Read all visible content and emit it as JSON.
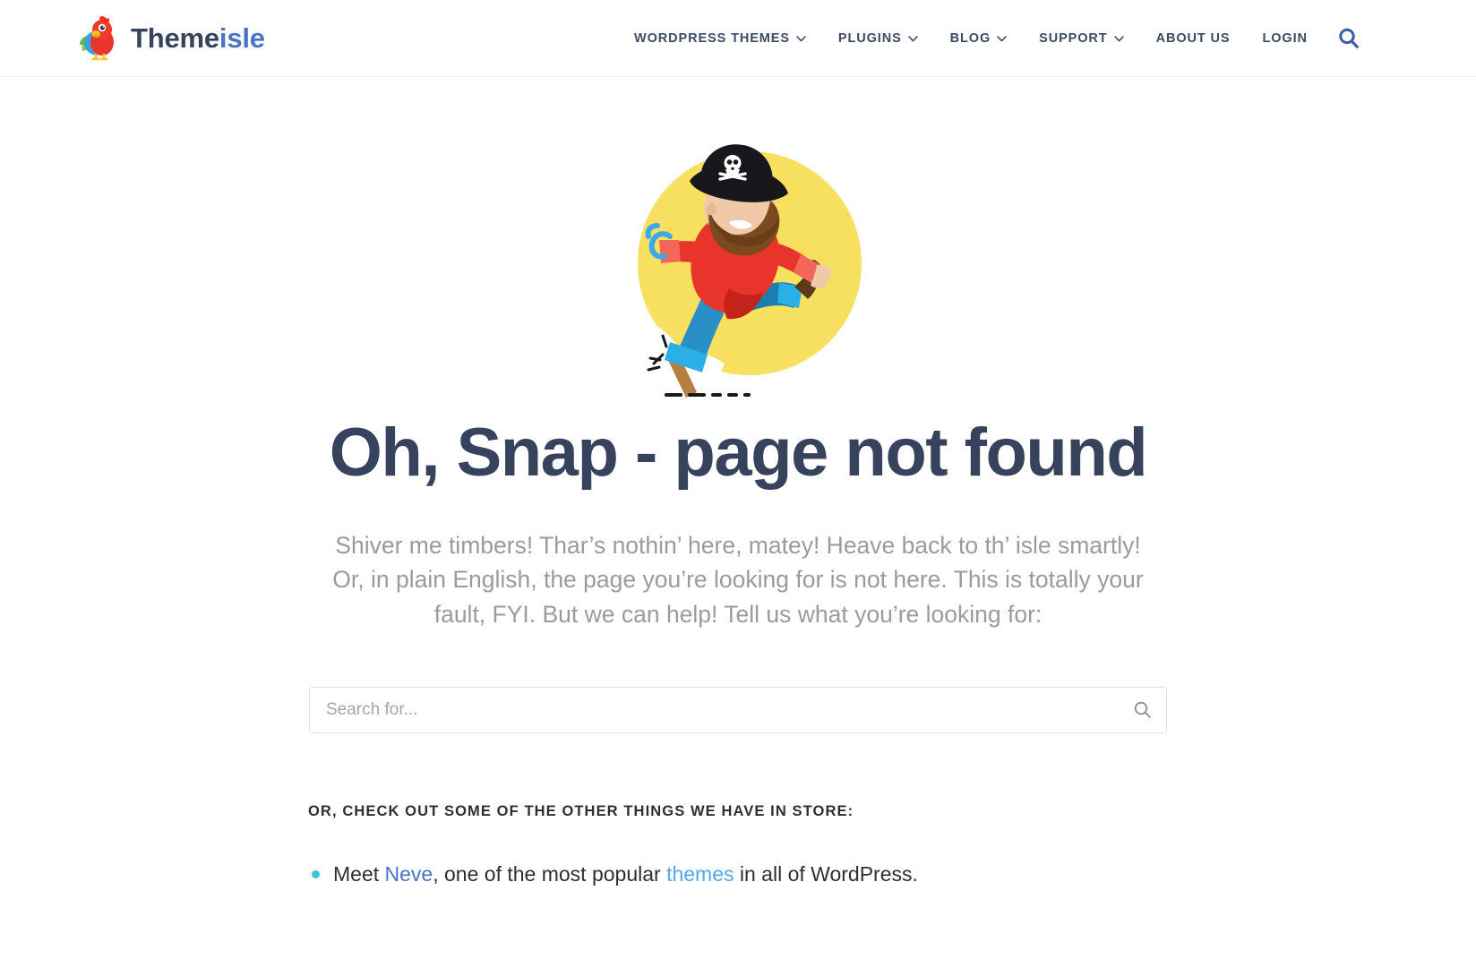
{
  "header": {
    "brand": {
      "name_part1": "Theme",
      "name_part2": "isle",
      "logo_icon": "parrot-logo-icon"
    },
    "nav_items": [
      {
        "label": "WORDPRESS THEMES",
        "has_dropdown": true
      },
      {
        "label": "PLUGINS",
        "has_dropdown": true
      },
      {
        "label": "BLOG",
        "has_dropdown": true
      },
      {
        "label": "SUPPORT",
        "has_dropdown": true
      },
      {
        "label": "ABOUT US",
        "has_dropdown": false
      },
      {
        "label": "LOGIN",
        "has_dropdown": false
      }
    ],
    "search_icon": "search-icon",
    "search_icon_color": "#3c5fa8"
  },
  "main": {
    "illustration": {
      "name": "pirate-404-illustration",
      "background_circle_color": "#f7e05f",
      "hat_color": "#17171c",
      "shirt_color": "#e8342a",
      "pants_color": "#1f9fd4",
      "beard_color": "#7b4a1e",
      "hook_color": "#3fa9e8",
      "peg_leg_color": "#b5803f"
    },
    "title": "Oh, Snap - page not found",
    "title_color": "#37425c",
    "paragraph_line1": "Shiver me timbers! Thar’s nothin’ here, matey! Heave back to th’ isle smartly!",
    "paragraph_line2": "Or, in plain English, the page you’re looking for is not here. This is totally your",
    "paragraph_line3": "fault, FYI. But we can help! Tell us what you’re looking for:",
    "paragraph_color": "#9b9b9b",
    "search": {
      "placeholder": "Search for...",
      "value": "",
      "submit_icon": "search-icon"
    },
    "other_things_label": "OR, CHECK OUT SOME OF THE OTHER THINGS WE HAVE IN STORE:",
    "list_items": [
      {
        "bullet_color": "#3fc3d8",
        "text_before": "Meet ",
        "link1": "Neve",
        "text_middle": ", one of the most popular ",
        "link2": "themes",
        "text_after": " in all of WordPress."
      }
    ]
  }
}
